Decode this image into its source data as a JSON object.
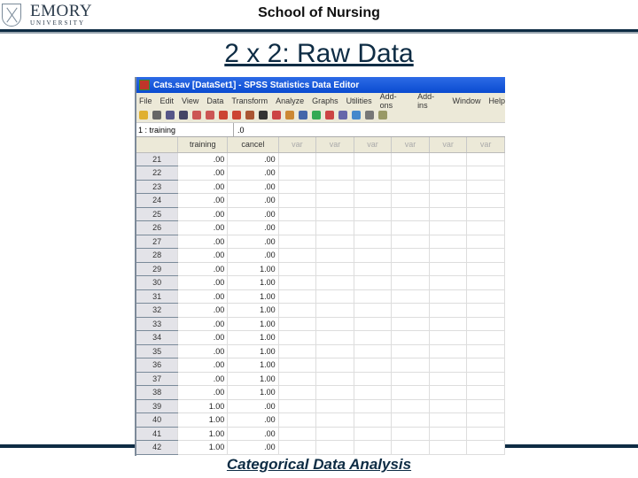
{
  "header": {
    "logo_name": "EMORY",
    "logo_sub": "UNIVERSITY",
    "school": "School of Nursing"
  },
  "slide_title": "2 x 2: Raw Data",
  "footer": "Categorical Data Analysis",
  "colors": {
    "navy": "#0e2c44",
    "titlebar": "#0a4bd0"
  },
  "spss": {
    "window_title": "Cats.sav [DataSet1] - SPSS Statistics Data Editor",
    "menu": [
      "File",
      "Edit",
      "View",
      "Data",
      "Transform",
      "Analyze",
      "Graphs",
      "Utilities",
      "Add-ons",
      "Add-ins",
      "Window",
      "Help"
    ],
    "cell_ref": "1 : training",
    "cell_value": ".0",
    "columns": [
      "training",
      "cancel",
      "var",
      "var",
      "var",
      "var",
      "var",
      "var"
    ],
    "rows": [
      {
        "n": "21",
        "training": ".00",
        "cancel": ".00"
      },
      {
        "n": "22",
        "training": ".00",
        "cancel": ".00"
      },
      {
        "n": "23",
        "training": ".00",
        "cancel": ".00"
      },
      {
        "n": "24",
        "training": ".00",
        "cancel": ".00"
      },
      {
        "n": "25",
        "training": ".00",
        "cancel": ".00"
      },
      {
        "n": "26",
        "training": ".00",
        "cancel": ".00"
      },
      {
        "n": "27",
        "training": ".00",
        "cancel": ".00"
      },
      {
        "n": "28",
        "training": ".00",
        "cancel": ".00"
      },
      {
        "n": "29",
        "training": ".00",
        "cancel": "1.00"
      },
      {
        "n": "30",
        "training": ".00",
        "cancel": "1.00"
      },
      {
        "n": "31",
        "training": ".00",
        "cancel": "1.00"
      },
      {
        "n": "32",
        "training": ".00",
        "cancel": "1.00"
      },
      {
        "n": "33",
        "training": ".00",
        "cancel": "1.00"
      },
      {
        "n": "34",
        "training": ".00",
        "cancel": "1.00"
      },
      {
        "n": "35",
        "training": ".00",
        "cancel": "1.00"
      },
      {
        "n": "36",
        "training": ".00",
        "cancel": "1.00"
      },
      {
        "n": "37",
        "training": ".00",
        "cancel": "1.00"
      },
      {
        "n": "38",
        "training": ".00",
        "cancel": "1.00"
      },
      {
        "n": "39",
        "training": "1.00",
        "cancel": ".00"
      },
      {
        "n": "40",
        "training": "1.00",
        "cancel": ".00"
      },
      {
        "n": "41",
        "training": "1.00",
        "cancel": ".00"
      },
      {
        "n": "42",
        "training": "1.00",
        "cancel": ".00"
      }
    ]
  }
}
